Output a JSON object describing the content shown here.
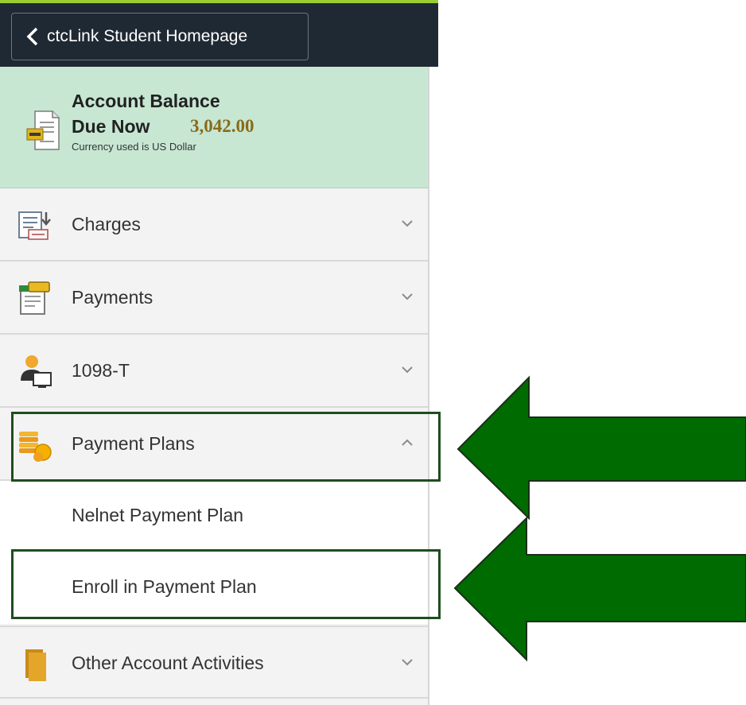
{
  "header": {
    "back_label": "ctcLink Student Homepage"
  },
  "balance": {
    "title": "Account Balance",
    "due_label": "Due Now",
    "amount": "3,042.00",
    "currency_note": "Currency used is US Dollar"
  },
  "menu": {
    "charges": "Charges",
    "payments": "Payments",
    "tax_form": "1098-T",
    "payment_plans": "Payment Plans",
    "nelnet": "Nelnet Payment Plan",
    "enroll": "Enroll in Payment Plan",
    "other": "Other Account Activities"
  },
  "colors": {
    "balance_bg": "#c7e7d3",
    "header_bg": "#1f2933",
    "header_accent": "#9acd32",
    "arrow_fill": "#006b00",
    "highlight_border": "#1f4d1f"
  },
  "icons": {
    "back": "chevron-left-icon",
    "balance": "statement-icon",
    "charges": "charges-icon",
    "payments": "payments-icon",
    "tax_form": "user-computer-icon",
    "payment_plans": "coins-icon",
    "other": "folder-icon",
    "collapsed": "chevron-down-icon",
    "expanded": "chevron-up-icon"
  }
}
